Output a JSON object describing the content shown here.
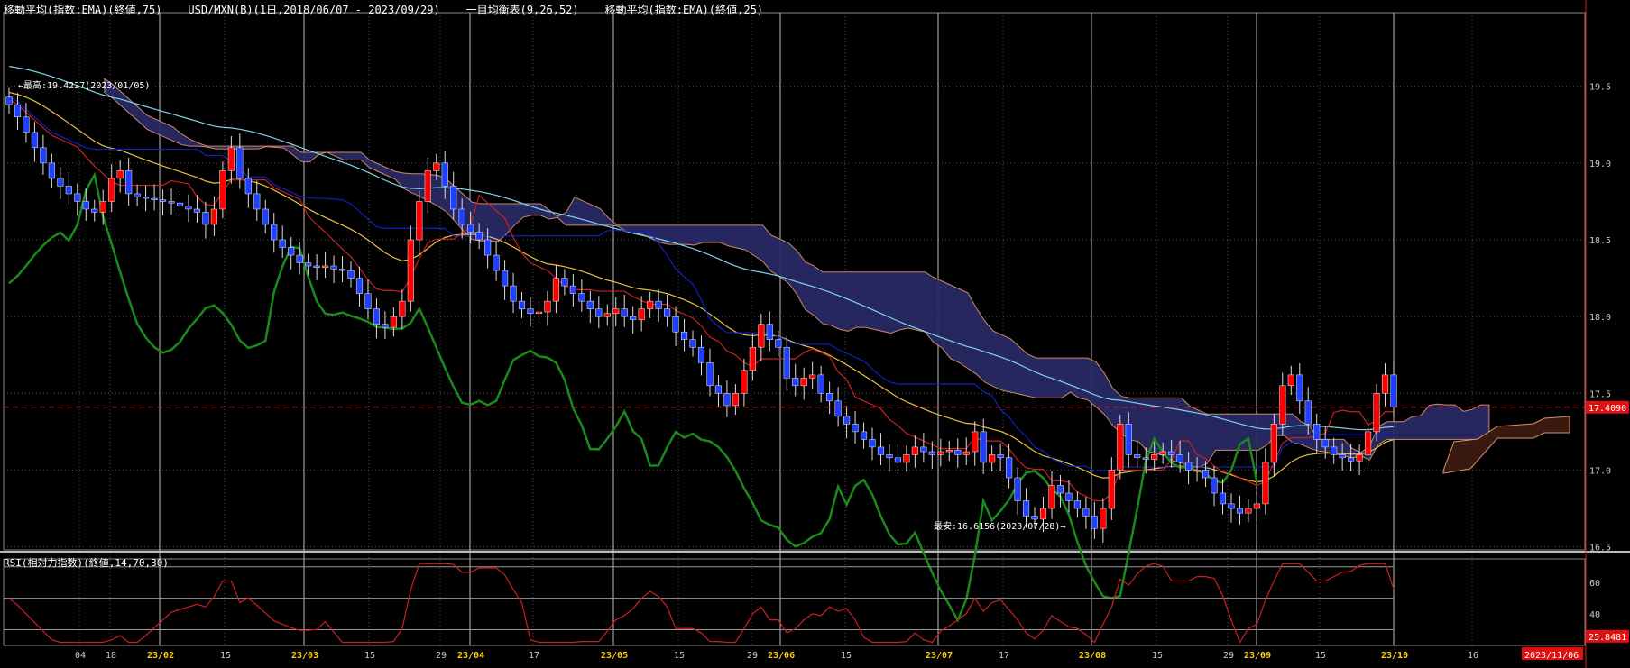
{
  "header": {
    "ema75": "移動平均(指数:EMA)(終値,75)",
    "symbol": "USD/MXN(B)(1日,2018/06/07 - 2023/09/29)",
    "ichimoku": "一目均衡表(9,26,52)",
    "ema25": "移動平均(指数:EMA)(終値,25)"
  },
  "rsi_header": "RSI(相対力指数)(終値,14,70,30)",
  "colors": {
    "background": "#000000",
    "up_candle": "#ff0000",
    "down_candle": "#2040ff",
    "cloud": "#2a2a66",
    "cloud_future": "#3a1a10",
    "chikou": "#1a8a1a",
    "ema75": "#7fd3e6",
    "ema25": "#e8c040",
    "tenkan": "#cc2020",
    "kijun": "#1020c0",
    "rsi_line": "#cc2020",
    "current_price_line": "#cc2020"
  },
  "chart_data": {
    "type": "candlestick",
    "title": "USD/MXN(B)(1日,2018/06/07 - 2023/09/29)",
    "y_axis": {
      "ticks": [
        "19.5",
        "19.0",
        "18.5",
        "18.0",
        "17.5",
        "17.0",
        "16.5"
      ],
      "range": [
        16.48,
        19.98
      ]
    },
    "x_axis": {
      "labels": [
        "04",
        "18",
        "23/02",
        "15",
        "23/03",
        "15",
        "29",
        "23/04",
        "17",
        "23/05",
        "15",
        "29",
        "23/06",
        "15",
        "23/07",
        "17",
        "23/08",
        "15",
        "29",
        "23/09",
        "15",
        "23/10",
        "16",
        "2023/11/06"
      ],
      "month_labels": [
        "23/02",
        "23/03",
        "23/04",
        "23/05",
        "23/06",
        "23/07",
        "23/08",
        "23/09",
        "23/10"
      ]
    },
    "current_price": "17.4090",
    "annotations": {
      "high": "←最高:19.4227(2023/01/05)",
      "low": "最安:16.6156(2023/07/28)→"
    },
    "closes": [
      19.38,
      19.3,
      19.2,
      19.1,
      19.0,
      18.9,
      18.85,
      18.8,
      18.75,
      18.7,
      18.68,
      18.75,
      18.9,
      18.95,
      18.8,
      18.78,
      18.77,
      18.76,
      18.75,
      18.74,
      18.72,
      18.7,
      18.68,
      18.6,
      18.7,
      18.95,
      19.1,
      18.9,
      18.8,
      18.7,
      18.6,
      18.5,
      18.45,
      18.4,
      18.35,
      18.33,
      18.32,
      18.33,
      18.31,
      18.3,
      18.25,
      18.15,
      18.05,
      17.95,
      17.93,
      18.0,
      18.1,
      18.5,
      18.75,
      18.95,
      19.0,
      18.85,
      18.7,
      18.6,
      18.55,
      18.5,
      18.4,
      18.3,
      18.2,
      18.1,
      18.05,
      18.02,
      18.03,
      18.1,
      18.25,
      18.2,
      18.15,
      18.1,
      18.05,
      18.0,
      18.02,
      18.05,
      18.0,
      17.98,
      18.05,
      18.1,
      18.05,
      18.0,
      17.9,
      17.85,
      17.8,
      17.7,
      17.55,
      17.5,
      17.42,
      17.5,
      17.65,
      17.8,
      17.95,
      17.85,
      17.8,
      17.6,
      17.55,
      17.6,
      17.62,
      17.5,
      17.45,
      17.35,
      17.3,
      17.25,
      17.2,
      17.15,
      17.1,
      17.08,
      17.05,
      17.1,
      17.15,
      17.12,
      17.1,
      17.12,
      17.13,
      17.1,
      17.12,
      17.25,
      17.05,
      17.1,
      17.08,
      16.95,
      16.8,
      16.7,
      16.68,
      16.75,
      16.9,
      16.85,
      16.8,
      16.75,
      16.7,
      16.62,
      16.75,
      17.0,
      17.3,
      17.1,
      17.08,
      17.07,
      17.1,
      17.12,
      17.1,
      17.05,
      17.0,
      17.0,
      16.95,
      16.85,
      16.78,
      16.75,
      16.72,
      16.75,
      16.78,
      17.05,
      17.3,
      17.55,
      17.62,
      17.45,
      17.3,
      17.2,
      17.15,
      17.1,
      17.08,
      17.06,
      17.1,
      17.25,
      17.5,
      17.62,
      17.41
    ],
    "rsi": {
      "levels": [
        "60",
        "40"
      ],
      "current": "25.8481"
    }
  }
}
